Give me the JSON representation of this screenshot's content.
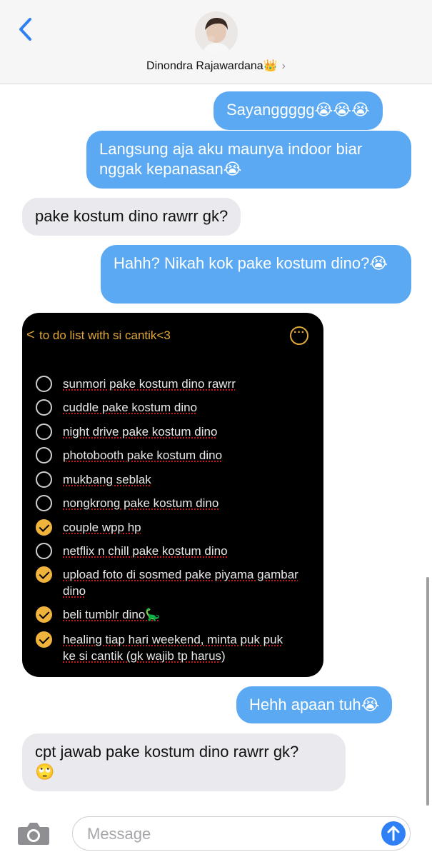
{
  "header": {
    "contact_name": "Dinondra Rajawardana",
    "name_emoji": "👑",
    "chevron": "›"
  },
  "messages": [
    {
      "id": "m1",
      "direction": "outgoing",
      "text": "Sayanggggg",
      "emoji": "😭😭😭"
    },
    {
      "id": "m2",
      "direction": "outgoing",
      "text": "Langsung aja aku maunya indoor biar nggak kepanasan",
      "emoji": "😭"
    },
    {
      "id": "m3",
      "direction": "incoming",
      "text": "pake kostum dino rawrr gk?"
    },
    {
      "id": "m4",
      "direction": "outgoing",
      "text": "Hahh? Nikah kok pake kostum dino?",
      "emoji": "😭"
    },
    {
      "id": "m6",
      "direction": "outgoing",
      "text": "Hehh apaan tuh",
      "emoji": "😭"
    },
    {
      "id": "m7",
      "direction": "incoming",
      "text": "cpt jawab pake kostum dino rawrr gk?",
      "emoji": "🙄"
    }
  ],
  "image_message": {
    "back_glyph": "<",
    "list_title": "to do list with si cantik<3",
    "more_glyph": "···",
    "items": [
      {
        "text": "sunmori pake kostum dino rawrr",
        "checked": false
      },
      {
        "text": "cuddle pake kostum dino",
        "checked": false
      },
      {
        "text": "night drive pake kostum dino",
        "checked": false
      },
      {
        "text": "photobooth pake kostum dino",
        "checked": false
      },
      {
        "text": "mukbang seblak",
        "checked": false
      },
      {
        "text": "nongkrong pake kostum dino",
        "checked": false
      },
      {
        "text": "couple wpp hp",
        "checked": true
      },
      {
        "text": "netflix n chill pake kostum dino",
        "checked": false
      },
      {
        "text": "upload foto di sosmed pake piyama gambar dino",
        "checked": true
      },
      {
        "text": "beli tumblr dino🦕",
        "checked": true
      },
      {
        "text": "healing tiap hari weekend, minta puk puk ke si cantik (gk wajib tp harus)",
        "checked": true
      }
    ]
  },
  "composer": {
    "placeholder": "Message"
  },
  "colors": {
    "outgoing_bubble": "#5aa9f2",
    "incoming_bubble": "#e9e9ee",
    "accent_blue": "#2f7ff5",
    "todo_accent": "#f0b43c"
  },
  "icons": {
    "back": "chevron-left-icon",
    "camera": "camera-icon",
    "send": "arrow-up-icon",
    "checkbox_done": "checkmark-circle-icon",
    "checkbox_empty": "empty-circle-icon"
  }
}
